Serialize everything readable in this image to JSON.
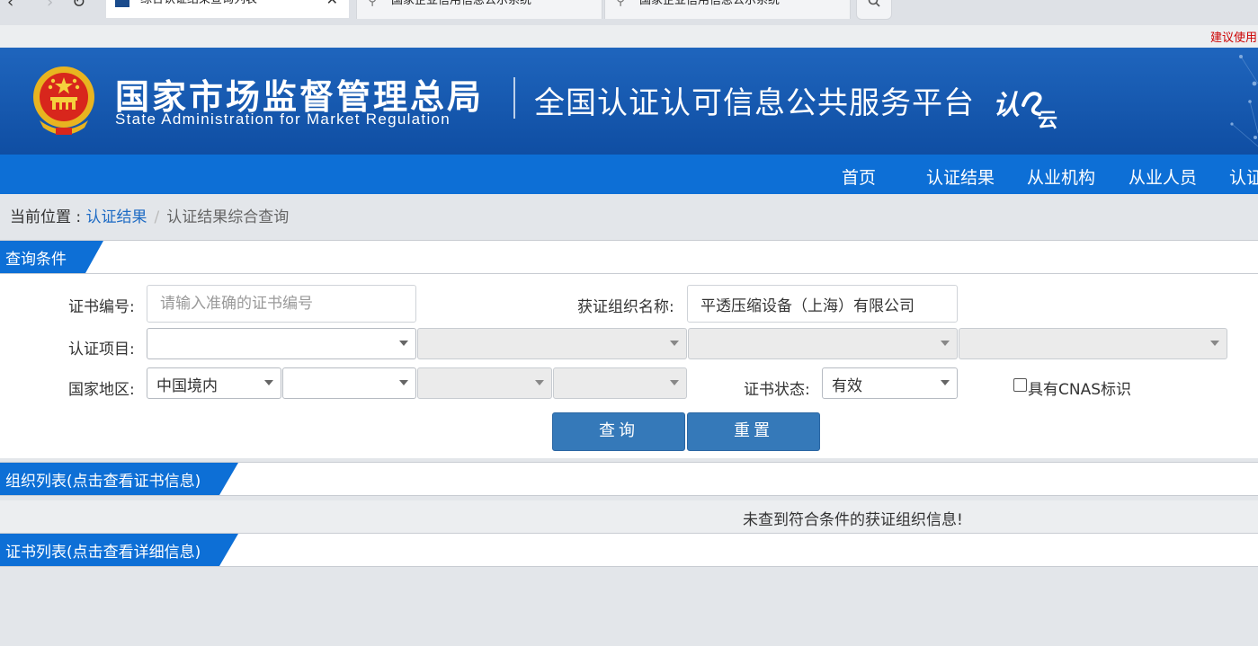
{
  "browser": {
    "tabs": [
      {
        "label": "综合认证结果查询列表",
        "active": true
      },
      {
        "label": "国家企业信用信息公示系统",
        "active": false
      },
      {
        "label": "国家企业信用信息公示系统",
        "active": false
      }
    ],
    "close_glyph": "✕",
    "search_glyph": "⌕",
    "back_glyph": "‹",
    "forward_glyph": "›",
    "reload_glyph": "↻",
    "link_glyph": "🔗"
  },
  "top_strip": {
    "suggest_text": "建议使用"
  },
  "header": {
    "agency_cn": "国家市场监督管理总局",
    "agency_en": "State Administration  for  Market Regulation",
    "platform_title": "全国认证认可信息公共服务平台",
    "platform_logo_text": "认e云"
  },
  "nav": {
    "items": [
      "首页",
      "认证结果",
      "从业机构",
      "从业人员",
      "认证"
    ]
  },
  "breadcrumb": {
    "prefix": "当前位置 : ",
    "link": "认证结果",
    "separator": "/",
    "current": "认证结果综合查询"
  },
  "query_section": {
    "title": "查询条件"
  },
  "form": {
    "cert_no_label": "证书编号:",
    "cert_no_placeholder": "请输入准确的证书编号",
    "cert_no_value": "",
    "org_name_label": "获证组织名称:",
    "org_name_value": "平透压缩设备（上海）有限公司",
    "project_label": "认证项目:",
    "project_selects": [
      "",
      "",
      "",
      ""
    ],
    "region_label": "国家地区:",
    "region_selects": [
      "中国境内",
      "",
      "",
      ""
    ],
    "status_label": "证书状态:",
    "status_value": "有效",
    "cnas_label": "具有CNAS标识",
    "cnas_checked": false,
    "search_button": "查询",
    "reset_button": "重置"
  },
  "org_section": {
    "title": "组织列表(点击查看证书信息)"
  },
  "org_result": {
    "message": "未查到符合条件的获证组织信息!"
  },
  "cert_section": {
    "title": "证书列表(点击查看详细信息)"
  },
  "colors": {
    "banner": "#1656ad",
    "navbar": "#0d6fd6",
    "section_tab": "#0d6fd6",
    "button": "#3579b9",
    "link": "#1e6bc4",
    "suggest": "#cc0000"
  }
}
